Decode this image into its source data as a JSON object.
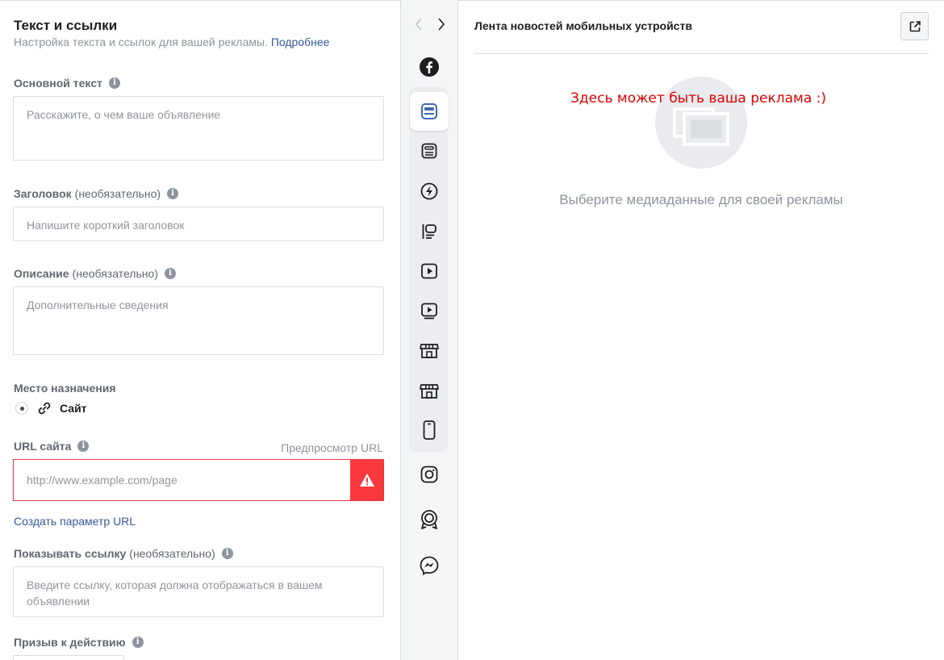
{
  "form": {
    "title": "Текст и ссылки",
    "subtitle": "Настройка текста и ссылок для вашей рекламы.",
    "subtitle_link": "Подробнее",
    "primary_text": {
      "label": "Основной текст",
      "placeholder": "Расскажите, о чем ваше объявление"
    },
    "headline": {
      "label": "Заголовок",
      "optional": "(необязательно)",
      "placeholder": "Напишите короткий заголовок"
    },
    "description": {
      "label": "Описание",
      "optional": "(необязательно)",
      "placeholder": "Дополнительные сведения"
    },
    "destination": {
      "label": "Место назначения",
      "option": "Сайт",
      "selected": true
    },
    "website_url": {
      "label": "URL сайта",
      "preview_link": "Предпросмотр URL",
      "placeholder": "http://www.example.com/page",
      "error": true
    },
    "create_param_link": "Создать параметр URL",
    "display_link": {
      "label": "Показывать ссылку",
      "optional": "(необязательно)",
      "placeholder": "Введите ссылку, которая должна отображаться в вашем объявлении"
    },
    "call_to_action": {
      "label": "Призыв к действию"
    }
  },
  "placements": [
    {
      "name": "facebook-icon"
    },
    {
      "name": "mobile-feed-icon",
      "active": true
    },
    {
      "name": "desktop-feed-icon"
    },
    {
      "name": "instant-articles-icon"
    },
    {
      "name": "right-column-icon"
    },
    {
      "name": "video-feed-icon"
    },
    {
      "name": "in-stream-video-icon"
    },
    {
      "name": "marketplace-icon"
    },
    {
      "name": "marketplace-desktop-icon"
    },
    {
      "name": "stories-icon"
    },
    {
      "name": "instagram-icon"
    },
    {
      "name": "audience-network-icon"
    },
    {
      "name": "messenger-icon"
    }
  ],
  "preview": {
    "title": "Лента новостей мобильных устройств",
    "annotation": "Здесь может быть ваша реклама :)",
    "empty_text": "Выберите медиаданные для своей рекламы"
  },
  "colors": {
    "link": "#385898",
    "error": "#fa383e",
    "annotation": "#e00000",
    "active_icon": "#4267b2"
  }
}
